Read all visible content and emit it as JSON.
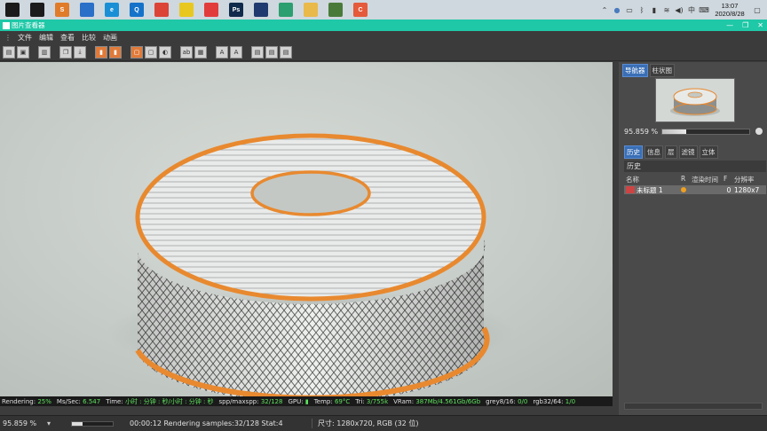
{
  "taskbar": {
    "apps": [
      {
        "name": "windows-start-icon",
        "label": "",
        "color": "#1b1b1b"
      },
      {
        "name": "task-view-icon",
        "label": "",
        "color": "#1b1b1b"
      },
      {
        "name": "sublime-icon",
        "label": "S",
        "color": "#e07b2a"
      },
      {
        "name": "user-icon",
        "label": "",
        "color": "#2a6fc8"
      },
      {
        "name": "edge-icon",
        "label": "e",
        "color": "#1a8fd6"
      },
      {
        "name": "search-app-icon",
        "label": "Q",
        "color": "#1572c9"
      },
      {
        "name": "chrome-icon",
        "label": "",
        "color": "#db4437"
      },
      {
        "name": "notes-icon",
        "label": "",
        "color": "#e8c820"
      },
      {
        "name": "video-app-icon",
        "label": "",
        "color": "#e23b3b"
      },
      {
        "name": "photoshop-icon",
        "label": "Ps",
        "color": "#0f2a4a"
      },
      {
        "name": "cinema4d-icon",
        "label": "",
        "color": "#1f3a6e"
      },
      {
        "name": "edge-dev-icon",
        "label": "",
        "color": "#2b9f6f"
      },
      {
        "name": "folder-icon",
        "label": "",
        "color": "#e9b949"
      },
      {
        "name": "renderer-icon",
        "label": "",
        "color": "#4a7a3a"
      },
      {
        "name": "cast-icon",
        "label": "C",
        "color": "#e45a3b"
      }
    ],
    "tray_lang": "中",
    "time": "13:07",
    "date": "2020/8/28"
  },
  "window": {
    "title": "图片查看器",
    "minimize": "—",
    "restore": "❐",
    "close": "✕"
  },
  "menu": [
    "文件",
    "编辑",
    "查看",
    "比较",
    "动画"
  ],
  "status_line": {
    "rendering_label": "Rendering:",
    "rendering_value": "25%",
    "ms_label": "Ms/Sec:",
    "ms_value": "6.547",
    "time_label": "Time:",
    "time_value": "小时 : 分钟 : 秒/小时 : 分钟 : 秒",
    "spp_label": "spp/maxspp:",
    "spp_value": "32/128",
    "gpu_label": "GPU:",
    "temp_label": "Temp:",
    "temp_value": "69°C",
    "tri_label": "Tri:",
    "tri_value": "3/755k",
    "vram_label": "VRam:",
    "vram_value": "387Mb/4.561Gb/6Gb",
    "grey_label": "grey8/16:",
    "grey_value": "0/0",
    "rgb_label": "rgb32/64:",
    "rgb_value": "1/0"
  },
  "bottom": {
    "zoom": "95.859 %",
    "progress": 0.25,
    "status": "00:00:12 Rendering samples:32/128 Stat:4",
    "size": "尺寸: 1280x720, RGB (32 位)"
  },
  "right_panel": {
    "top_tabs": [
      "导航器",
      "柱状图"
    ],
    "zoom": "95.859 %",
    "zoom_fraction": 0.28,
    "lower_tabs": [
      "历史",
      "信息",
      "层",
      "滤镜",
      "立体"
    ],
    "history_title": "历史",
    "columns": [
      "名称",
      "R",
      "渲染时间",
      "F",
      "分辨率"
    ],
    "row": {
      "name": "未标题 1",
      "time": "",
      "f": "0",
      "res": "1280x7"
    }
  },
  "colors": {
    "accent": "#1fc8a7",
    "ring_orange": "#e8892f",
    "status_green": "#5ee35e"
  }
}
